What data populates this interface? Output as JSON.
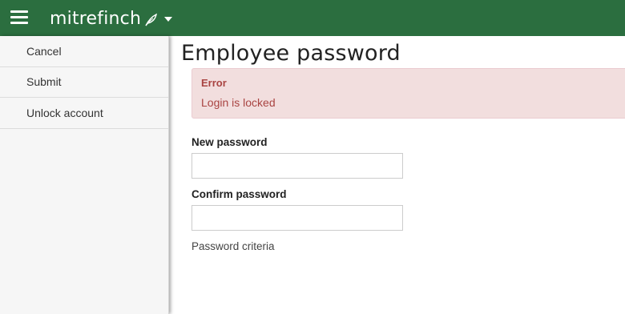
{
  "header": {
    "brand": "mitrefinch",
    "brand_color": "#2b6e3f"
  },
  "sidebar": {
    "items": [
      {
        "label": "Cancel"
      },
      {
        "label": "Submit"
      },
      {
        "label": "Unlock account"
      }
    ]
  },
  "main": {
    "title": "Employee password",
    "alert": {
      "title": "Error",
      "message": "Login is locked"
    },
    "new_password": {
      "label": "New password",
      "value": ""
    },
    "confirm_password": {
      "label": "Confirm password",
      "value": ""
    },
    "criteria_link": "Password criteria"
  }
}
